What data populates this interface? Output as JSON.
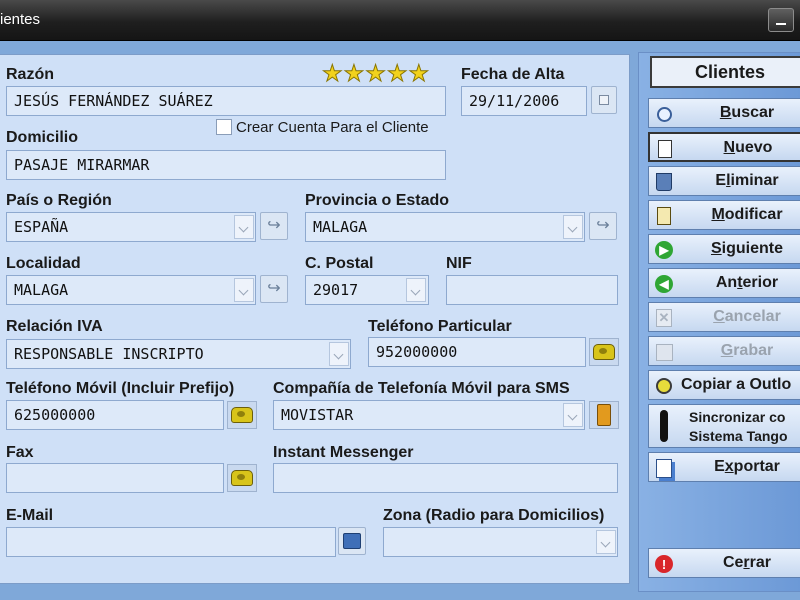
{
  "window": {
    "title": "ientes"
  },
  "form": {
    "razon": {
      "label": "Razón",
      "value": "JESÚS FERNÁNDEZ SUÁREZ",
      "stars": "★★★★★"
    },
    "fecha_alta": {
      "label": "Fecha de Alta",
      "value": "29/11/2006"
    },
    "crear_cuenta": {
      "label": "Crear Cuenta Para el Cliente",
      "checked": false
    },
    "domicilio": {
      "label": "Domicilio",
      "value": "PASAJE MIRARMAR"
    },
    "pais": {
      "label": "País o Región",
      "value": "ESPAÑA"
    },
    "provincia": {
      "label": "Provincia o Estado",
      "value": "MALAGA"
    },
    "localidad": {
      "label": "Localidad",
      "value": "MALAGA"
    },
    "cpostal": {
      "label": "C. Postal",
      "value": "29017"
    },
    "nif": {
      "label": "NIF",
      "value": ""
    },
    "relacion_iva": {
      "label": "Relación IVA",
      "value": "RESPONSABLE INSCRIPTO"
    },
    "tel_particular": {
      "label": "Teléfono Particular",
      "value": "952000000"
    },
    "tel_movil": {
      "label": "Teléfono Móvil (Incluir Prefijo)",
      "value": "625000000"
    },
    "compania_sms": {
      "label": "Compañía de Telefonía Móvil para SMS",
      "value": "MOVISTAR"
    },
    "fax": {
      "label": "Fax",
      "value": ""
    },
    "messenger": {
      "label": "Instant Messenger",
      "value": ""
    },
    "email": {
      "label": "E-Mail",
      "value": ""
    },
    "zona": {
      "label": "Zona (Radio para Domicilios)",
      "value": ""
    }
  },
  "sidebar": {
    "title": "Clientes",
    "buttons": [
      {
        "id": "buscar",
        "u": "B",
        "rest": "uscar",
        "enabled": true,
        "icon": "magnifier-icon"
      },
      {
        "id": "nuevo",
        "u": "N",
        "rest": "uevo",
        "enabled": true,
        "icon": "new-document-icon"
      },
      {
        "id": "eliminar",
        "pre": "E",
        "u": "l",
        "rest": "iminar",
        "enabled": true,
        "icon": "trash-icon"
      },
      {
        "id": "modificar",
        "u": "M",
        "rest": "odificar",
        "enabled": true,
        "icon": "edit-document-icon"
      },
      {
        "id": "siguiente",
        "u": "S",
        "rest": "iguiente",
        "enabled": true,
        "icon": "arrow-right-icon"
      },
      {
        "id": "anterior",
        "pre": "An",
        "u": "t",
        "rest": "erior",
        "enabled": true,
        "icon": "arrow-left-icon"
      },
      {
        "id": "cancelar",
        "u": "C",
        "rest": "ancelar",
        "enabled": false,
        "icon": "cancel-icon"
      },
      {
        "id": "grabar",
        "u": "G",
        "rest": "rabar",
        "enabled": false,
        "icon": "save-icon"
      },
      {
        "id": "copiar",
        "label": "Copiar a Outlo",
        "enabled": true,
        "icon": "outlook-icon"
      },
      {
        "id": "sincronizar",
        "line1": "Sincronizar co",
        "line2": "Sistema Tango",
        "enabled": true,
        "icon": "tango-icon"
      },
      {
        "id": "exportar",
        "pre": "E",
        "u": "x",
        "rest": "portar",
        "enabled": true,
        "icon": "export-icon"
      },
      {
        "id": "cerrar",
        "pre": "Ce",
        "u": "r",
        "rest": "rar",
        "enabled": true,
        "icon": "close-icon"
      }
    ]
  },
  "colors": {
    "panel_bg": "#cfe0f7",
    "field_bg": "#dde9f9",
    "sidebar_bg": "#7fa8d9",
    "star": "#f2d21c",
    "titlebar": "#1f1f1f"
  }
}
